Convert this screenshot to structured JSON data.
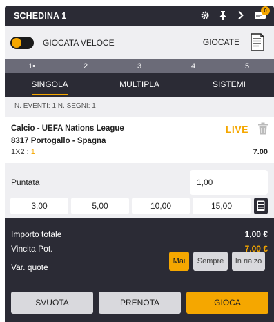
{
  "header": {
    "title": "SCHEDINA 1",
    "badge_count": "0"
  },
  "quick": {
    "toggle_label": "GIOCATA VELOCE",
    "giocate_label": "GIOCATE"
  },
  "numbers": [
    "1•",
    "2",
    "3",
    "4",
    "5"
  ],
  "tabs": [
    {
      "label": "SINGOLA",
      "active": true
    },
    {
      "label": "MULTIPLA",
      "active": false
    },
    {
      "label": "SISTEMI",
      "active": false
    }
  ],
  "events_info": "N. EVENTI: 1  N. SEGNI: 1",
  "event": {
    "competition": "Calcio - UEFA Nations League",
    "live": "LIVE",
    "match": "8317  Portogallo  -  Spagna",
    "bet_type": "1X2 : ",
    "pick": "1",
    "odd": "7.00"
  },
  "stake": {
    "label": "Puntata",
    "value": "1,00",
    "presets": [
      "3,00",
      "5,00",
      "10,00",
      "15,00"
    ]
  },
  "summary": {
    "total_label": "Importo totale",
    "total_value": "1,00 €",
    "win_label": "Vincita Pot.",
    "win_value": "7,00 €",
    "var_label": "Var. quote",
    "var_options": [
      "Mai",
      "Sempre",
      "In rialzo"
    ]
  },
  "actions": {
    "svuota": "SVUOTA",
    "prenota": "PRENOTA",
    "gioca": "GIOCA"
  },
  "colors": {
    "accent": "#f5a700",
    "dark": "#2b2b35",
    "strip": "#6b6b78",
    "light": "#efeff2"
  }
}
